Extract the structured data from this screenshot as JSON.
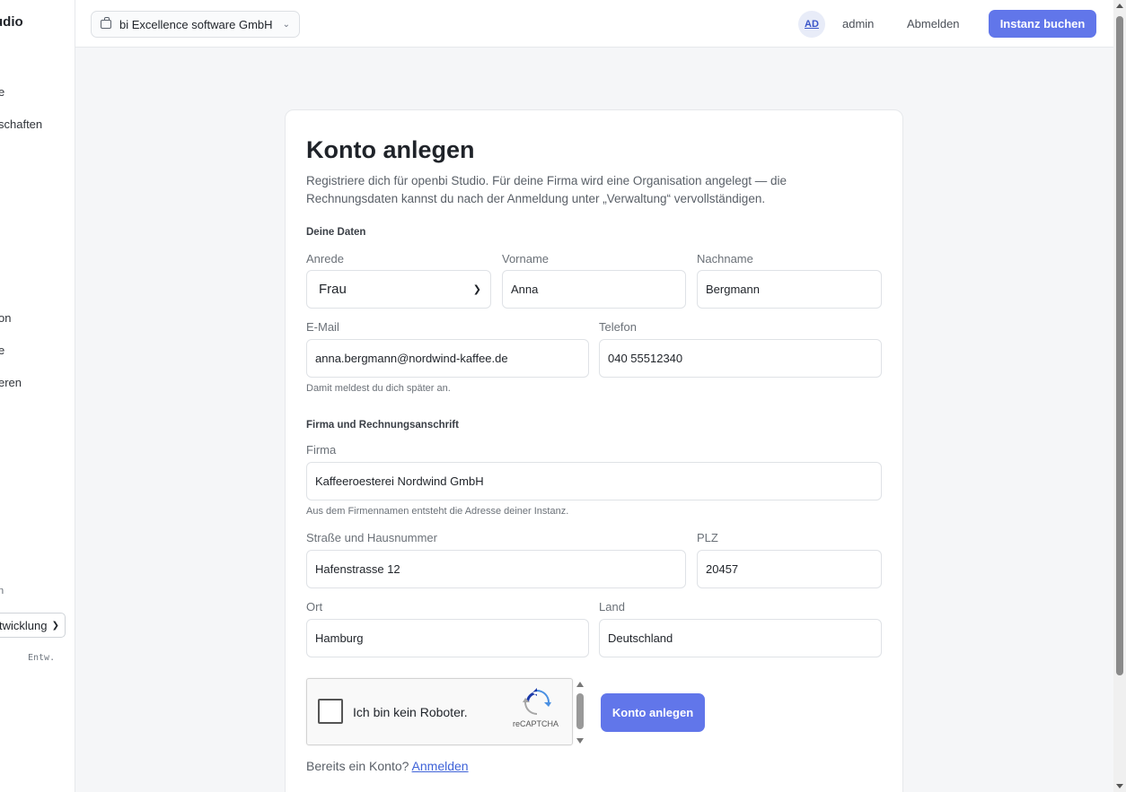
{
  "sidebar": {
    "brand": "udio",
    "items": [
      {
        "label": "e"
      },
      {
        "label": "schaften"
      },
      {
        "label": "on"
      },
      {
        "label": "e"
      },
      {
        "label": "eren"
      }
    ],
    "env_label": "n",
    "env_select_value": "twicklung",
    "env_code": "Entw."
  },
  "topbar": {
    "org_name": "bi Excellence software GmbH",
    "avatar_initials": "AD",
    "username": "admin",
    "logout_label": "Abmelden",
    "book_label": "Instanz buchen"
  },
  "form": {
    "title": "Konto anlegen",
    "intro": "Registriere dich für openbi Studio. Für deine Firma wird eine Organisation angelegt — die Rechnungsdaten kannst du nach der Anmeldung unter „Verwaltung“ vervollständigen.",
    "section_personal": "Deine Daten",
    "salutation": {
      "label": "Anrede",
      "value": "Frau"
    },
    "first_name": {
      "label": "Vorname",
      "value": "Anna"
    },
    "last_name": {
      "label": "Nachname",
      "value": "Bergmann"
    },
    "email": {
      "label": "E-Mail",
      "value": "anna.bergmann@nordwind-kaffee.de",
      "hint": "Damit meldest du dich später an."
    },
    "phone": {
      "label": "Telefon",
      "value": "040 55512340"
    },
    "section_company": "Firma und Rechnungsanschrift",
    "company": {
      "label": "Firma",
      "value": "Kaffeeroesterei Nordwind GmbH",
      "hint": "Aus dem Firmennamen entsteht die Adresse deiner Instanz."
    },
    "street": {
      "label": "Straße und Hausnummer",
      "value": "Hafenstrasse 12"
    },
    "zip": {
      "label": "PLZ",
      "value": "20457"
    },
    "city": {
      "label": "Ort",
      "value": "Hamburg"
    },
    "country": {
      "label": "Land",
      "value": "Deutschland"
    },
    "captcha_text": "Ich bin kein Roboter.",
    "captcha_brand": "reCAPTCHA",
    "submit_label": "Konto anlegen",
    "login_prompt": "Bereits ein Konto?",
    "login_link": "Anmelden"
  },
  "colors": {
    "accent": "#6176ea",
    "link": "#3f63d8"
  }
}
